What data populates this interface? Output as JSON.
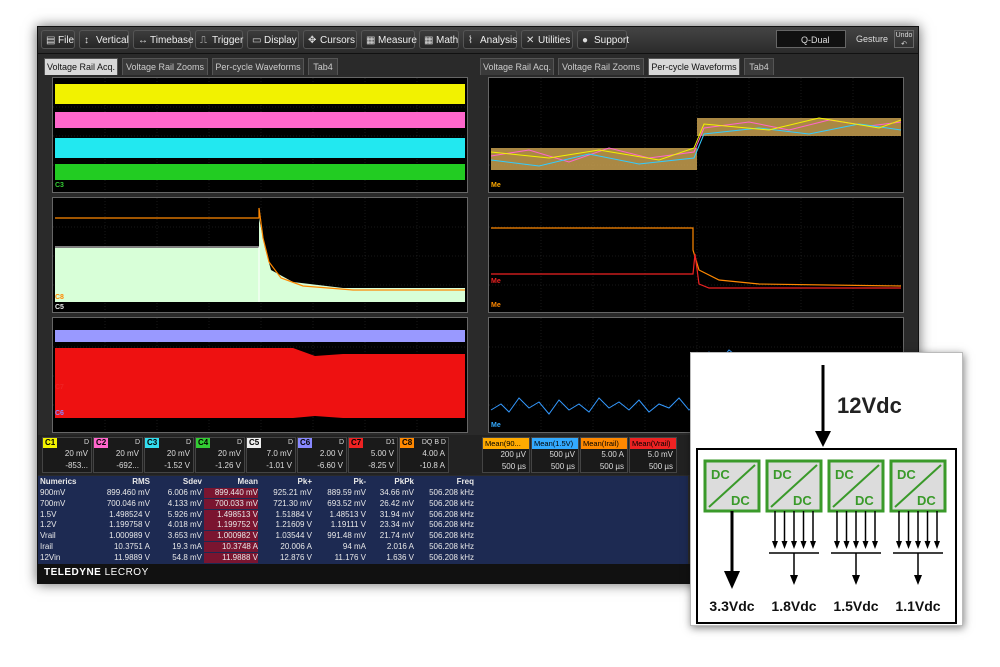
{
  "menu": {
    "items": [
      {
        "label": "File",
        "icon": "file-icon"
      },
      {
        "label": "Vertical",
        "icon": "vertical-icon"
      },
      {
        "label": "Timebase",
        "icon": "timebase-icon"
      },
      {
        "label": "Trigger",
        "icon": "trigger-icon"
      },
      {
        "label": "Display",
        "icon": "display-icon"
      },
      {
        "label": "Cursors",
        "icon": "cursors-icon"
      },
      {
        "label": "Measure",
        "icon": "measure-icon"
      },
      {
        "label": "Math",
        "icon": "math-icon"
      },
      {
        "label": "Analysis",
        "icon": "analysis-icon"
      },
      {
        "label": "Utilities",
        "icon": "utilities-icon"
      },
      {
        "label": "Support",
        "icon": "support-icon"
      }
    ],
    "mode_badge": "Q-Dual",
    "gesture": "Gesture",
    "undo": "Undo"
  },
  "left_tabs": [
    "Voltage Rail Acq.",
    "Voltage Rail Zooms",
    "Per-cycle Waveforms",
    "Tab4"
  ],
  "right_tabs": [
    "Voltage Rail Acq.",
    "Voltage Rail Zooms",
    "Per-cycle Waveforms",
    "Tab4"
  ],
  "grid_labels": {
    "left1": "C3",
    "left2a": "C8",
    "left2b": "C5",
    "left3a": "C7",
    "left3b": "C6",
    "right1": "Me",
    "right2a": "Me",
    "right2b": "Me",
    "right3": "Me"
  },
  "channels": [
    {
      "tag": "C1",
      "coupling": "D",
      "scale": "20 mV",
      "offset": "-853...",
      "color": "#f2f200"
    },
    {
      "tag": "C2",
      "coupling": "D",
      "scale": "20 mV",
      "offset": "-692...",
      "color": "#ff66cc"
    },
    {
      "tag": "C3",
      "coupling": "D",
      "scale": "20 mV",
      "offset": "-1.52 V",
      "color": "#33ddee"
    },
    {
      "tag": "C4",
      "coupling": "D",
      "scale": "20 mV",
      "offset": "-1.26 V",
      "color": "#33cc33"
    },
    {
      "tag": "C5",
      "coupling": "D",
      "scale": "7.0 mV",
      "offset": "-1.01 V",
      "color": "#eeeeee"
    },
    {
      "tag": "C6",
      "coupling": "D",
      "scale": "2.00 V",
      "offset": "-6.60 V",
      "color": "#8888ff"
    },
    {
      "tag": "C7",
      "coupling": "D1",
      "scale": "5.00 V",
      "offset": "-8.25 V",
      "color": "#ee2222"
    },
    {
      "tag": "C8",
      "coupling": "DQ B D",
      "scale": "4.00 A",
      "offset": "-10.8 A",
      "color": "#ff8800"
    }
  ],
  "math_channels": [
    {
      "tag": "Mean(90...",
      "scale": "200 µV",
      "time": "500 µs",
      "color": "#ffaa00"
    },
    {
      "tag": "Mean(1.5V)",
      "scale": "500 µV",
      "time": "500 µs",
      "color": "#33aaff"
    },
    {
      "tag": "Mean(Irail)",
      "scale": "5.00 A",
      "time": "500 µs",
      "color": "#ff8800"
    },
    {
      "tag": "Mean(Vrail)",
      "scale": "5.0 mV",
      "time": "500 µs",
      "color": "#ee2222"
    }
  ],
  "numerics": {
    "headers": [
      "Numerics",
      "RMS",
      "Sdev",
      "Mean",
      "Pk+",
      "Pk-",
      "PkPk",
      "Freq"
    ],
    "rows": [
      [
        "900mV",
        "899.460 mV",
        "6.006 mV",
        "899.440 mV",
        "925.21 mV",
        "889.59 mV",
        "34.66 mV",
        "506.208 kHz"
      ],
      [
        "700mV",
        "700.046 mV",
        "4.133 mV",
        "700.033 mV",
        "721.30 mV",
        "693.52 mV",
        "26.42 mV",
        "506.208 kHz"
      ],
      [
        "1.5V",
        "1.498524 V",
        "5.926 mV",
        "1.498513 V",
        "1.51884 V",
        "1.48513 V",
        "31.94 mV",
        "506.208 kHz"
      ],
      [
        "1.2V",
        "1.199758 V",
        "4.018 mV",
        "1.199752 V",
        "1.21609 V",
        "1.19111 V",
        "23.34 mV",
        "506.208 kHz"
      ],
      [
        "Vrail",
        "1.000989 V",
        "3.653 mV",
        "1.000982 V",
        "1.03544 V",
        "991.48 mV",
        "21.74 mV",
        "506.208 kHz"
      ],
      [
        "Irail",
        "10.3751 A",
        "19.3 mA",
        "10.3748 A",
        "20.006 A",
        "94 mA",
        "2.016 A",
        "506.208 kHz"
      ],
      [
        "12Vin",
        "11.9889 V",
        "54.8 mV",
        "11.9888 V",
        "12.876 V",
        "11.176 V",
        "1.636 V",
        "506.208 kHz"
      ]
    ]
  },
  "brand": {
    "name": "TELEDYNE",
    "sub": "LECROY"
  },
  "diagram": {
    "input": "12Vdc",
    "converter_top": "DC",
    "converter_bottom": "DC",
    "outputs": [
      "3.3Vdc",
      "1.8Vdc",
      "1.5Vdc",
      "1.1Vdc"
    ]
  }
}
